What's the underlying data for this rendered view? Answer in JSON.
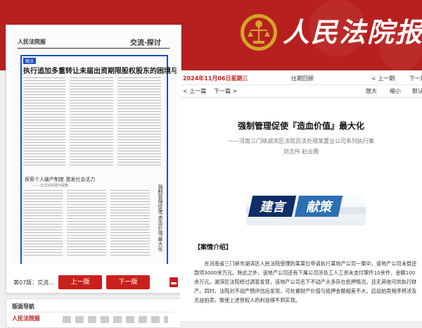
{
  "masthead": {
    "title": "人民法院报"
  },
  "left_panel": {
    "newspaper": {
      "masthead": "人民法院报",
      "section": "交流·探讨",
      "tag": "观点",
      "headline1": "执行追加多重转让未届出资期限股权股东的困境与对策",
      "headline2": "探索个人破产制度 激发社会活力",
      "subheadline2": "——以司法实践为视角",
      "vertical_title": "强制管理促使'造血价值'最大化"
    },
    "page_label": "第07版：交流…",
    "prev_button": "上一版",
    "next_button": "下一版",
    "pdf_icon": "pdf-icon"
  },
  "nav_panel": {
    "title": "版面导航",
    "logo": "人民法院报"
  },
  "toolbar": {
    "date": "2024年11月06日星期三",
    "past": "往期回顾",
    "prev_issue": "< 上一期",
    "next_issue": "下一期 >",
    "prev_article": "< 上一篇",
    "next_article": "下一篇 >",
    "zoom_in": "放大",
    "zoom_out": "缩小",
    "default": "默认"
  },
  "article": {
    "title": "强制管理促使『造血价值』最大化",
    "subtitle": "——河南三门峡湖滨区法院员法处理某置业公司系列执行案",
    "author": "刘志伟 赵云霞",
    "banner_text1": "建言",
    "banner_text2": "献策",
    "section_heading": "【案情介绍】",
    "body": "在河南省三门峡市湖滨区人民法院受理的某某位申请执行某地产公司一案中，该地产公司未偿还款项3000余万元。除此之外，该地产公司还有下属公司涉及工人工资未支付案件10余件，金额100余万元。湖滨区法院经过调查发现，该地产公司名下不动产大多存在抵押情况，且无其他可供执行财产。同时，法院对不动产预评估后发现，可处置财产价值与抵押金额相差不大，启动拍卖程序将涉及无益拍卖，致使上述债权人的利益得不到实现。"
  },
  "colors": {
    "brand_red": "#b7201e",
    "button_red": "#c9201d",
    "selection_blue": "#1e4fbf"
  }
}
